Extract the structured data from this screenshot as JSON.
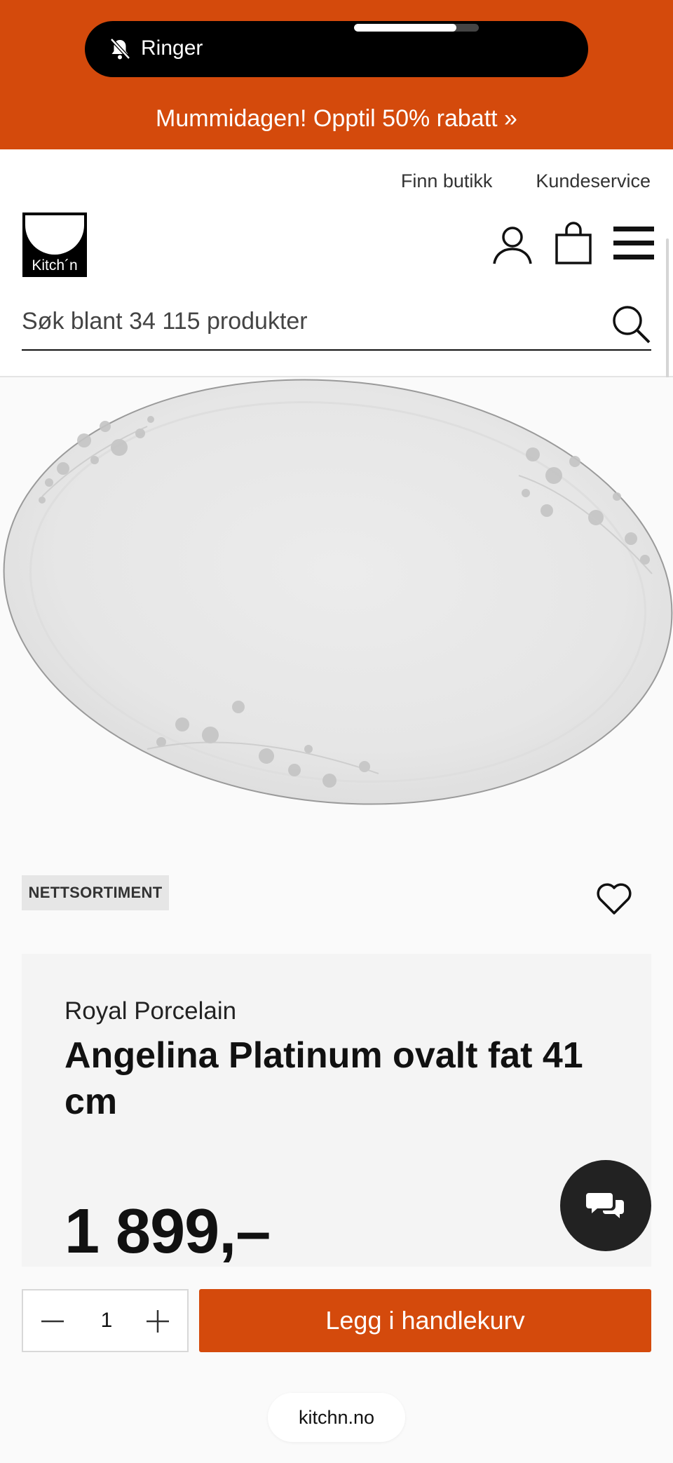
{
  "status": {
    "ringer_label": "Ringer",
    "ringer_icon": "bell-slash-icon",
    "volume_level": 0.82
  },
  "promo": {
    "text": "Mummidagen! Opptil 50% rabatt »",
    "background_color": "#d44a0c"
  },
  "header": {
    "util_links": [
      "Finn butikk",
      "Kundeservice"
    ],
    "logo_text": "Kitch´n",
    "icons": [
      "account-icon",
      "cart-icon",
      "menu-icon"
    ],
    "search": {
      "placeholder": "Søk blant 34 115 produkter",
      "icon": "search-icon"
    }
  },
  "product": {
    "badge": "NETTSORTIMENT",
    "brand": "Royal Porcelain",
    "title": "Angelina Platinum ovalt fat 41 cm",
    "price": "1 899,–",
    "wishlist_icon": "heart-icon"
  },
  "purchase": {
    "quantity": "1",
    "minus_icon": "minus-icon",
    "plus_icon": "plus-icon",
    "add_to_cart_label": "Legg i handlekurv",
    "accent_color": "#d44a0c"
  },
  "chat": {
    "icon": "chat-bubbles-icon"
  },
  "browser": {
    "url": "kitchn.no"
  }
}
